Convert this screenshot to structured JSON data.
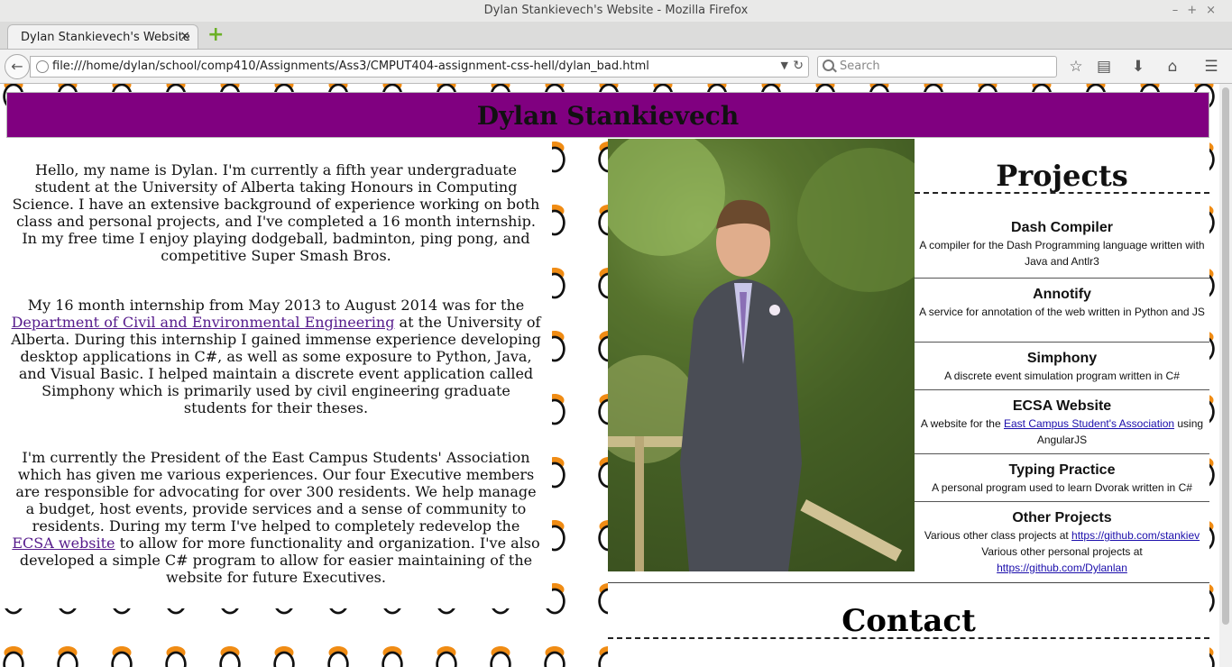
{
  "window": {
    "title": "Dylan Stankievech's Website - Mozilla Firefox"
  },
  "tab": {
    "title": "Dylan Stankievech's Website",
    "close": "×"
  },
  "toolbar": {
    "url": "file:///home/dylan/school/comp410/Assignments/Ass3/CMPUT404-assignment-css-hell/dylan_bad.html",
    "search_placeholder": "Search",
    "icons": [
      "back-icon",
      "reload-icon",
      "star-icon",
      "reading-list-icon",
      "download-icon",
      "home-icon",
      "menu-icon"
    ]
  },
  "page": {
    "heading": "Dylan Stankievech",
    "intro": [
      "Hello, my name is Dylan. I'm currently a fifth year undergraduate student at the University of Alberta taking Honours in Computing Science. I have an extensive background of experience working on both class and personal projects, and I've completed a 16 month internship. In my free time I enjoy playing dodgeball, badminton, ping pong, and competitive Super Smash Bros."
    ],
    "internship": {
      "before": "My 16 month internship from May 2013 to August 2014 was for the ",
      "link": "Department of Civil and Environmental Engineering",
      "after": " at the University of Alberta. During this internship I gained immense experience developing desktop applications in C#, as well as some exposure to Python, Java, and Visual Basic. I helped maintain a discrete event application called Simphony which is primarily used by civil engineering graduate students for their theses."
    },
    "ecsa": {
      "before": "I'm currently the President of the East Campus Students' Association which has given me various experiences. Our four Executive members are responsible for advocating for over 300 residents. We help manage a budget, host events, provide services and a sense of community to residents. During my term I've helped to completely redevelop the ",
      "link": "ECSA website",
      "after": " to allow for more functionality and organization. I've also developed a simple C# program to allow for easier maintaining of the website for future Executives."
    },
    "projects": {
      "title": "Projects",
      "dash": {
        "name": "Dash Compiler",
        "desc": "A compiler for the Dash Programming language written with Java and Antlr3"
      },
      "annotify": {
        "name": "Annotify",
        "desc": "A service for annotation of the web written in Python and JS"
      },
      "simphony": {
        "name": "Simphony",
        "desc": "A discrete event simulation program written in C#"
      },
      "ecsa": {
        "name": "ECSA Website",
        "before": "A website for the ",
        "link": "East Campus Student's Association",
        "after": " using AngularJS"
      },
      "typing": {
        "name": "Typing Practice",
        "desc": "A personal program used to learn Dvorak written in C#"
      },
      "other": {
        "name": "Other Projects",
        "line1_text": "Various other class projects at ",
        "line1_link": "https://github.com/stankiev",
        "line2_text": "Various other personal projects at ",
        "line2_link": "https://github.com/Dylanlan"
      }
    },
    "contact_title": "Contact"
  },
  "colors": {
    "banner": "#800080",
    "link_visited": "#551a8b",
    "link": "#1a0dab"
  }
}
